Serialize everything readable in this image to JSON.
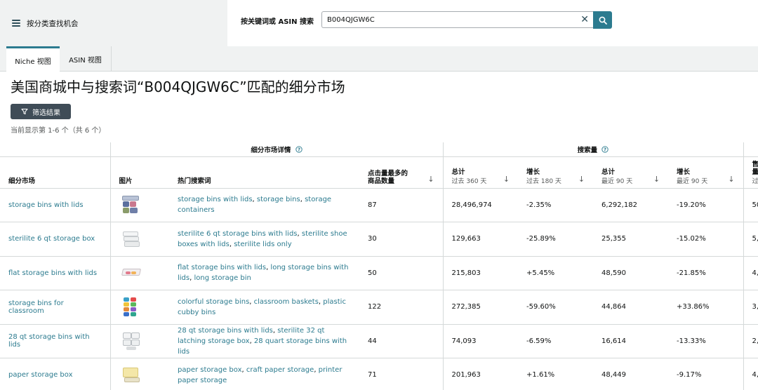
{
  "nav": {
    "menu_label": "按分类查找机会",
    "search_label": "按关键词或 ASIN 搜索",
    "search_value": "B004QJGW6C"
  },
  "tabs": [
    {
      "label": "Niche 视图",
      "active": true
    },
    {
      "label": "ASIN 视图",
      "active": false
    }
  ],
  "page": {
    "title": "美国商城中与搜索词“B004QJGW6C”匹配的细分市场",
    "filter_label": "筛选结果",
    "showing": "当前显示第 1-6 个（共 6 个）"
  },
  "table": {
    "group_headers": {
      "details": "细分市场详情",
      "search_volume": "搜索量",
      "sales_partial": "售"
    },
    "columns": {
      "niche": "细分市场",
      "image": "图片",
      "terms": "热门搜索词",
      "clicks_line1": "点击量最多的",
      "clicks_line2": "商品数量",
      "total360": "总计",
      "total360_sub": "过去 360 天",
      "growth180": "增长",
      "growth180_sub": "过去 180 天",
      "total90": "总计",
      "total90_sub": "最近 90 天",
      "growth90": "增长",
      "growth90_sub": "最近 90 天",
      "sales_line1": "售",
      "sales_line2": "量",
      "sales_sub": "过"
    },
    "rows": [
      {
        "niche": "storage bins with lids",
        "terms": [
          "storage bins with lids",
          "storage bins",
          "storage containers"
        ],
        "clicks": "87",
        "total360": "28,496,974",
        "growth180": "-2.35%",
        "total90": "6,292,182",
        "growth90": "-19.20%",
        "sales": "50"
      },
      {
        "niche": "sterilite 6 qt storage box",
        "terms": [
          "sterilite 6 qt storage bins with lids",
          "sterilite shoe boxes with lids",
          "sterilite lids only"
        ],
        "clicks": "30",
        "total360": "129,663",
        "growth180": "-25.89%",
        "total90": "25,355",
        "growth90": "-15.02%",
        "sales": "5,"
      },
      {
        "niche": "flat storage bins with lids",
        "terms": [
          "flat storage bins with lids",
          "long storage bins with lids",
          "long storage bin"
        ],
        "clicks": "50",
        "total360": "215,803",
        "growth180": "+5.45%",
        "total90": "48,590",
        "growth90": "-21.85%",
        "sales": "4,"
      },
      {
        "niche": "storage bins for classroom",
        "terms": [
          "colorful storage bins",
          "classroom baskets",
          "plastic cubby bins"
        ],
        "clicks": "122",
        "total360": "272,385",
        "growth180": "-59.60%",
        "total90": "44,864",
        "growth90": "+33.86%",
        "sales": "3,"
      },
      {
        "niche": "28 qt storage bins with lids",
        "terms": [
          "28 qt storage bins with lids",
          "sterilite 32 qt latching storage box",
          "28 quart storage bins with lids"
        ],
        "clicks": "44",
        "total360": "74,093",
        "growth180": "-6.59%",
        "total90": "16,614",
        "growth90": "-13.33%",
        "sales": "2,"
      },
      {
        "niche": "paper storage box",
        "terms": [
          "paper storage box",
          "craft paper storage",
          "printer paper storage"
        ],
        "clicks": "71",
        "total360": "201,963",
        "growth180": "+1.61%",
        "total90": "48,449",
        "growth90": "-9.17%",
        "sales": "4,"
      }
    ]
  },
  "colors": {
    "link": "#2c7b8f",
    "button_dark": "#3f4c57",
    "band": "#f0f2f2"
  }
}
